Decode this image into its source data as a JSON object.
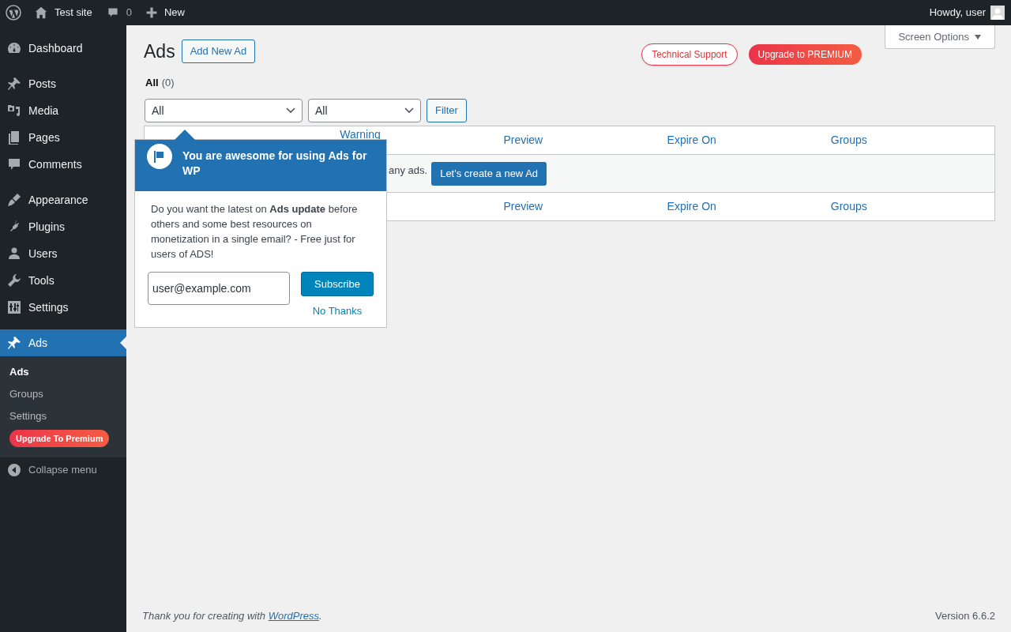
{
  "admin_bar": {
    "site": "Test site",
    "comments": "0",
    "new": "New",
    "greeting": "Howdy, user"
  },
  "sidebar": {
    "menu_groups": [
      [
        {
          "label": "Dashboard",
          "selected": false
        }
      ],
      [
        {
          "label": "Posts",
          "selected": false
        },
        {
          "label": "Media",
          "selected": false
        },
        {
          "label": "Pages",
          "selected": false
        },
        {
          "label": "Comments",
          "selected": false
        }
      ],
      [
        {
          "label": "Appearance",
          "selected": false
        },
        {
          "label": "Plugins",
          "selected": false
        },
        {
          "label": "Users",
          "selected": false
        },
        {
          "label": "Tools",
          "selected": false
        },
        {
          "label": "Settings",
          "selected": false
        }
      ],
      [
        {
          "label": "Ads",
          "selected": true
        }
      ]
    ],
    "submenu": [
      {
        "kind": "link",
        "label": "Ads",
        "selected": true
      },
      {
        "kind": "link",
        "label": "Groups",
        "selected": false
      },
      {
        "kind": "link",
        "label": "Settings",
        "selected": false
      },
      {
        "kind": "badge",
        "label": "Upgrade To Premium",
        "selected": false
      }
    ],
    "collapse": "Collapse menu"
  },
  "header": {
    "title": "Ads",
    "add_button": "Add New Ad",
    "support_button": "Technical Support",
    "premium_button": "Upgrade to PREMIUM",
    "screen_options": "Screen Options"
  },
  "views": [
    {
      "label": "All",
      "count": "(0)",
      "selected": true
    }
  ],
  "filters": {
    "selects": [
      "All",
      "All"
    ],
    "button": "Filter"
  },
  "table": {
    "header_columns": [
      "Warning",
      "Preview",
      "Expire On",
      "Groups"
    ],
    "empty_text": "any ads.",
    "create_button": "Let's create a new Ad",
    "footer_columns": [
      "Preview",
      "Expire On",
      "Groups"
    ]
  },
  "popup": {
    "title": "You are awesome for using Ads for WP",
    "body": "Do you want the latest on **Ads update** before others and some best resources on monetization in a single email? - Free just for users of ADS!",
    "email": "user@example.com",
    "subscribe": "Subscribe",
    "dismiss": "No Thanks"
  },
  "footer": {
    "text_before": "Thank you for creating with ",
    "link": "WordPress",
    "text_after": ".",
    "version": "Version 6.6.2"
  }
}
